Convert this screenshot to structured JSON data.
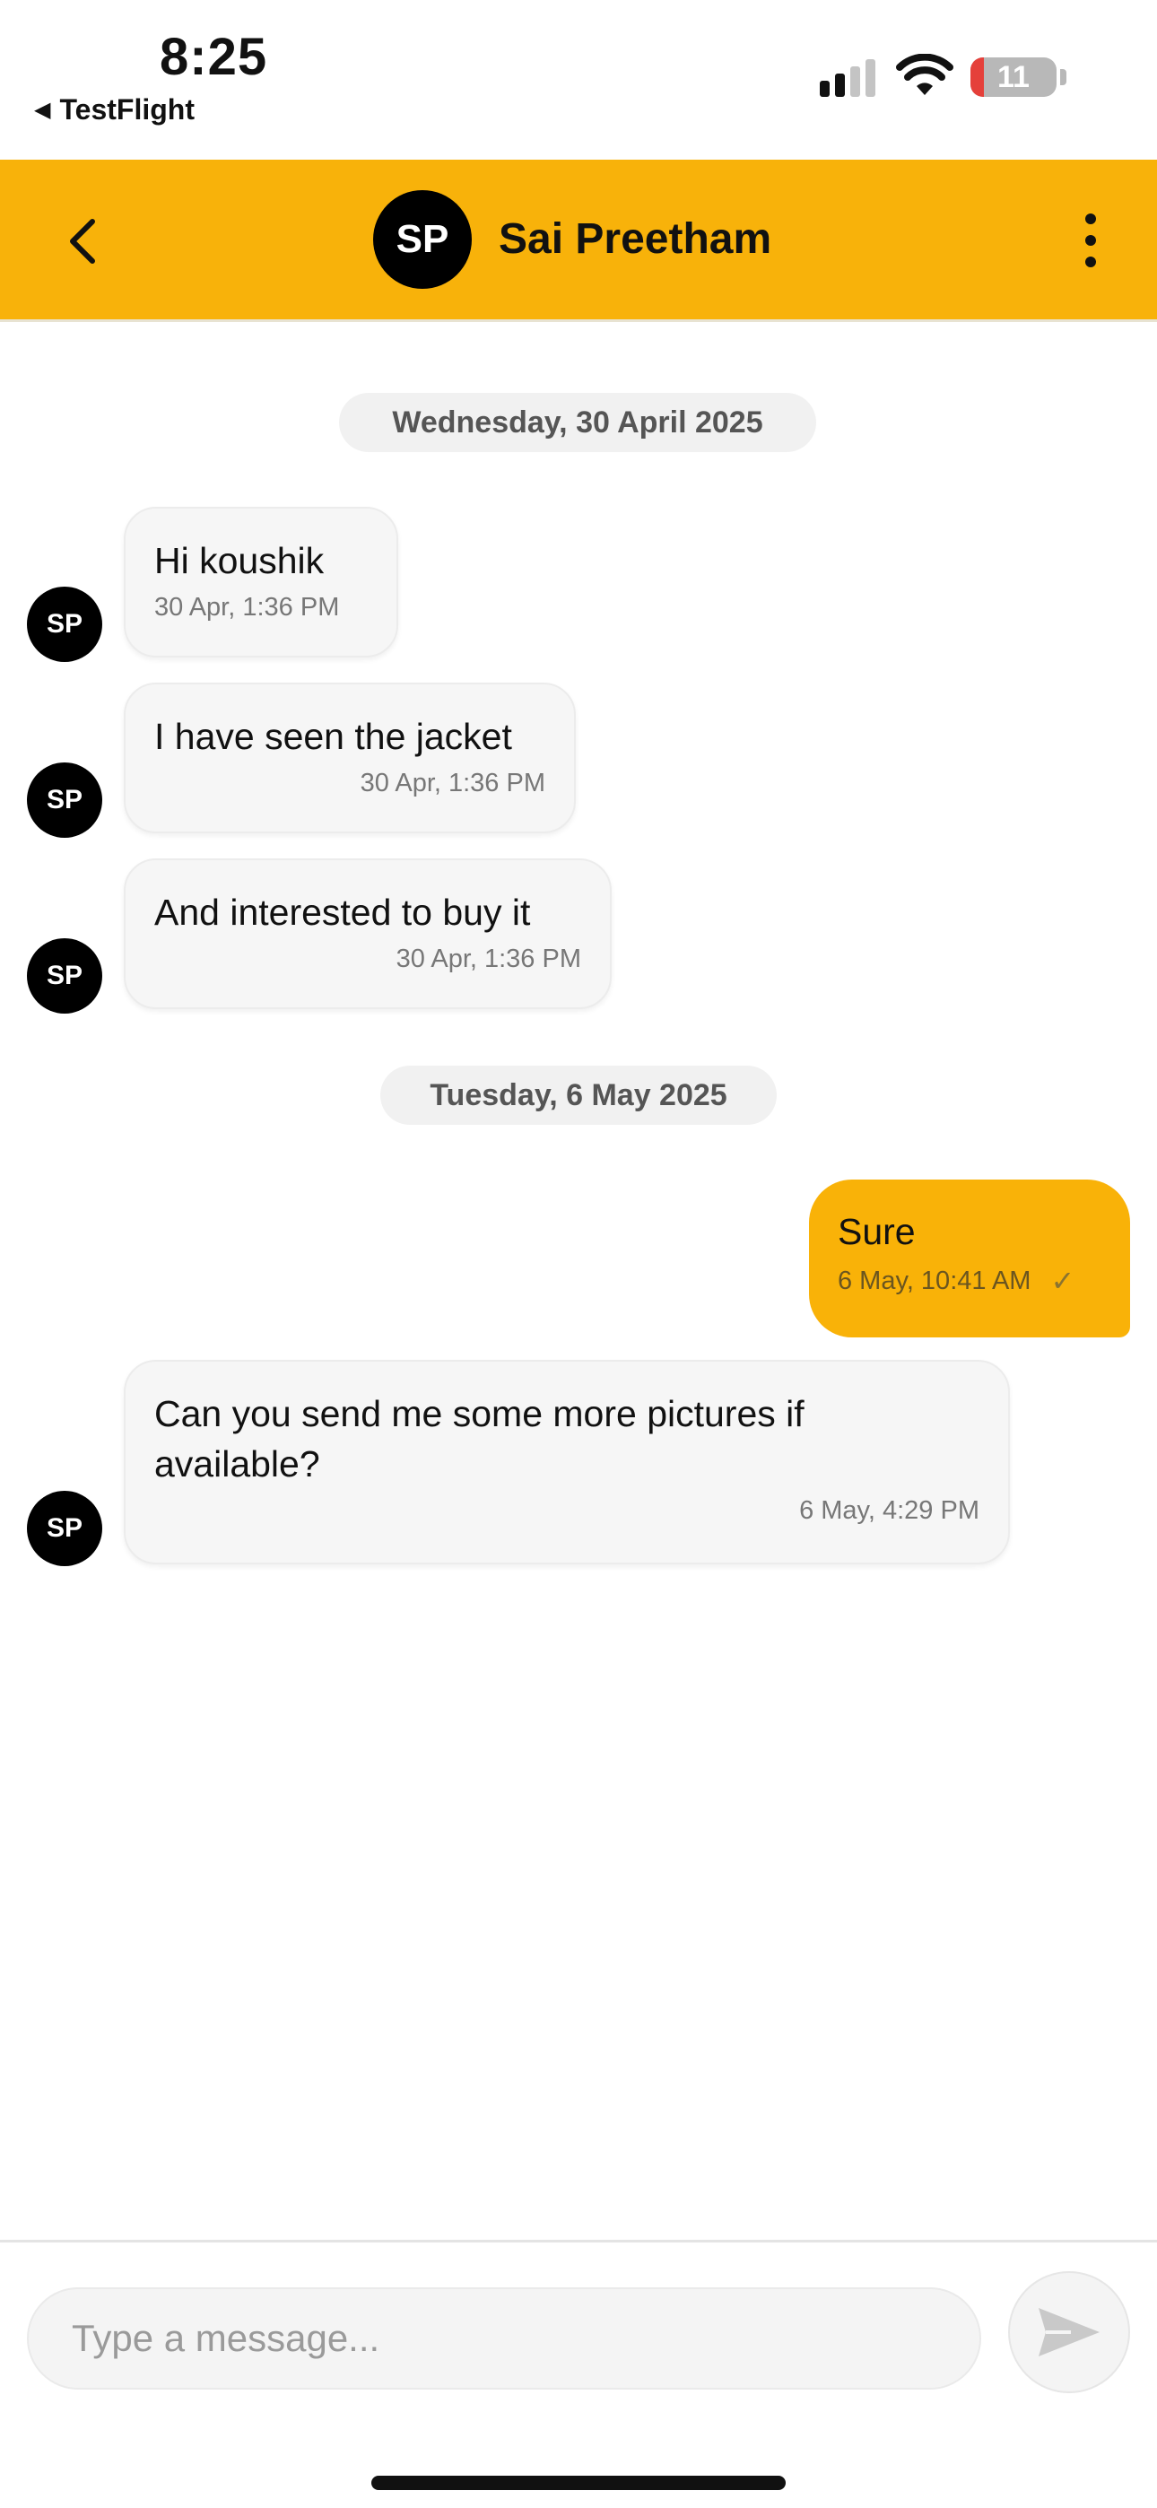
{
  "status_bar": {
    "time": "8:25",
    "back_app": "TestFlight",
    "battery_level": "11",
    "icons": [
      "back-triangle-icon",
      "signal-icon",
      "wifi-icon",
      "battery-icon"
    ]
  },
  "header": {
    "avatar_initials": "SP",
    "contact_name": "Sai Preetham",
    "icons": [
      "chevron-left-icon",
      "more-vertical-icon"
    ],
    "background_color": "#f8b20a"
  },
  "conversation": {
    "date_separators": [
      "Wednesday, 30 April 2025",
      "Tuesday, 6 May 2025"
    ],
    "messages": [
      {
        "direction": "incoming",
        "avatar": "SP",
        "text": "Hi koushik",
        "time": "30 Apr, 1:36 PM"
      },
      {
        "direction": "incoming",
        "avatar": "SP",
        "text": "I have seen the jacket",
        "time": "30 Apr, 1:36 PM"
      },
      {
        "direction": "incoming",
        "avatar": "SP",
        "text": "And interested to buy it",
        "time": "30 Apr, 1:36 PM"
      },
      {
        "direction": "outgoing",
        "text": "Sure",
        "time": "6 May, 10:41 AM",
        "status_icon": "check-icon"
      },
      {
        "direction": "incoming",
        "avatar": "SP",
        "text": "Can you send me some more pictures if available?",
        "time": "6 May, 4:29 PM"
      }
    ]
  },
  "composer": {
    "placeholder": "Type a message...",
    "send_icon": "send-icon"
  }
}
